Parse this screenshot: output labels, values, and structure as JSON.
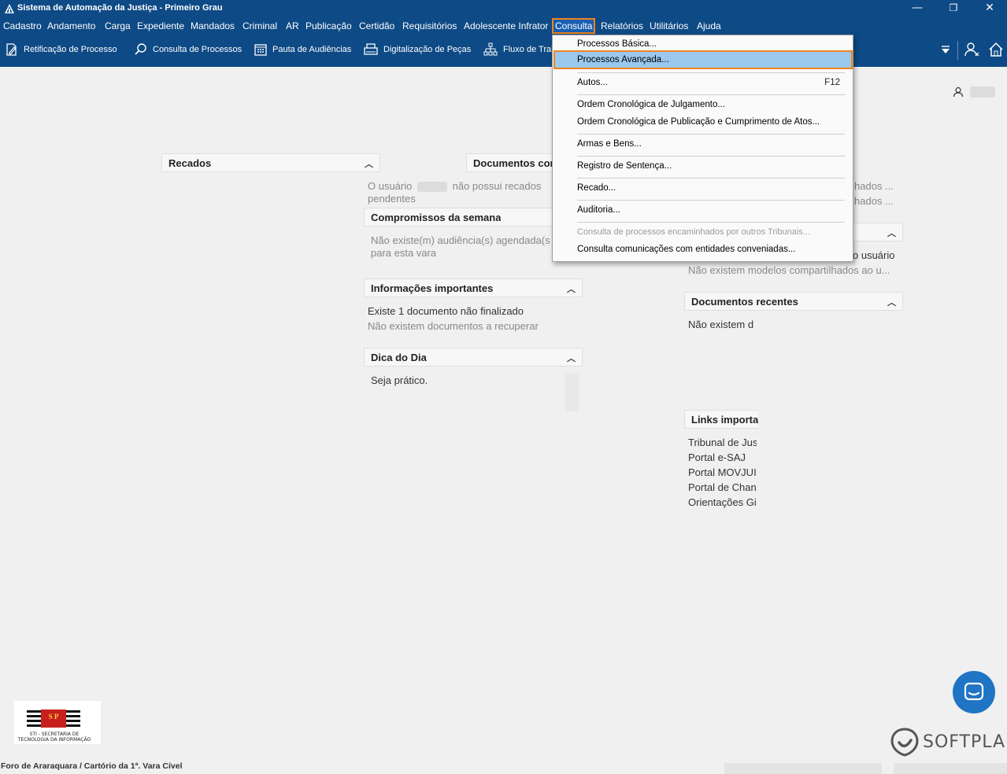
{
  "window": {
    "title": "Sistema de Automação da Justiça - Primeiro Grau",
    "minimize_glyph": "—",
    "restore_glyph": "❐",
    "close_glyph": "✕"
  },
  "menu": {
    "cadastro": "Cadastro",
    "andamento": "Andamento",
    "carga": "Carga",
    "expediente": "Expediente",
    "mandados": "Mandados",
    "criminal": "Criminal",
    "ar": "AR",
    "publicacao": "Publicação",
    "certidao": "Certidão",
    "requisitorios": "Requisitórios",
    "adolescente": "Adolescente Infrator",
    "consulta": "Consulta",
    "relatorios": "Relatórios",
    "utilitarios": "Utilitários",
    "ajuda": "Ajuda"
  },
  "toolbar": {
    "retificacao": "Retificação de Processo",
    "consulta_processos": "Consulta de Processos",
    "pauta": "Pauta de Audiências",
    "digitalizacao": "Digitalização de Peças",
    "fluxo": "Fluxo de Tral"
  },
  "dropdown": {
    "basica": "Processos Básica...",
    "avancada": "Processos Avançada...",
    "autos": "Autos...",
    "autos_shortcut": "F12",
    "ordem_julgamento": "Ordem Cronológica de Julgamento...",
    "ordem_publicacao": "Ordem Cronológica de Publicação e Cumprimento de Atos...",
    "armas": "Armas e Bens...",
    "registro": "Registro de Sentença...",
    "recado": "Recado...",
    "auditoria": "Auditoria...",
    "encaminhados": "Consulta de processos encaminhados por outros Tribunais...",
    "comunicacoes": "Consulta comunicações com entidades conveniadas..."
  },
  "panels": {
    "recados": "Recados",
    "documentos": "Documentos cor",
    "usuario_prefix": "O usuário",
    "usuario_suffix": "não possui recados",
    "pendentes": "pendentes",
    "compromissos": "Compromissos da semana",
    "audiencia_line1": "Não existe(m) audiência(s) agendada(s",
    "audiencia_line2": "para esta vara",
    "informacoes": "Informações importantes",
    "info_line1": "Existe 1 documento não finalizado",
    "info_line2": "Não existem documentos a recuperar",
    "dica": "Dica do Dia",
    "dica_text": "Seja prático.",
    "right_frag1": "hados ...",
    "right_frag2": "hados ...",
    "right_frag3": "o usuário",
    "modelos": "Não existem modelos compartilhados ao u...",
    "doc_recentes": "Documentos recentes",
    "doc_recentes_text": "Não existem d",
    "links": "Links importa",
    "link1": "Tribunal de Jus",
    "link2": "Portal e-SAJ",
    "link3": "Portal MOVJUI",
    "link4": "Portal de Chan",
    "link5": "Orientações Gi"
  },
  "brand": {
    "softplan": "SOFTPLAN",
    "sti_line1": "STI - SECRETARIA DE",
    "sti_line2": "TECNOLOGIA DA INFORMAÇÃO",
    "sti_seal": "S P"
  },
  "footer": "Foro de Araraquara / Cartório da 1ª. Vara Cível",
  "colors": {
    "bar": "#0e4a85",
    "highlight": "#9ac8ee",
    "focus": "#f0831e",
    "chat": "#1f74c4"
  }
}
